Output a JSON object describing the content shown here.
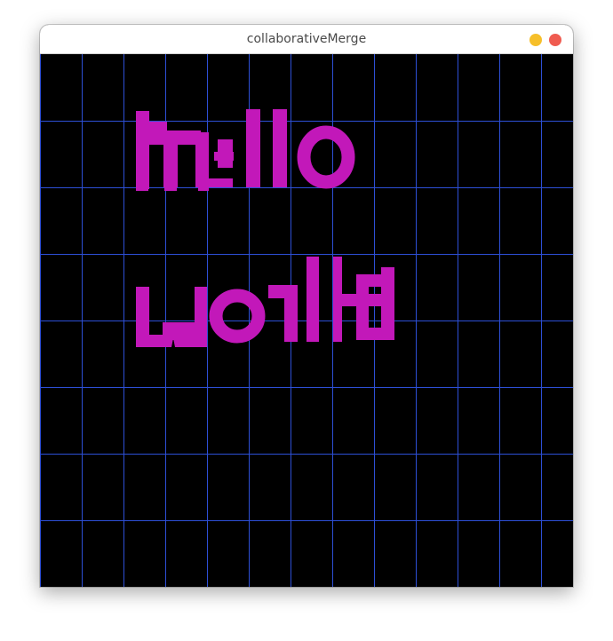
{
  "window": {
    "title": "collaborativeMerge"
  },
  "titlebar_buttons": {
    "minimize_color": "#f6bf2a",
    "close_color": "#ef5b50"
  },
  "canvas": {
    "background": "#000000",
    "grid_color": "#2d4fd6",
    "grid_columns": 13,
    "grid_rows": 8,
    "text_color": "#c218b9",
    "lines": [
      "hello",
      "world"
    ]
  }
}
